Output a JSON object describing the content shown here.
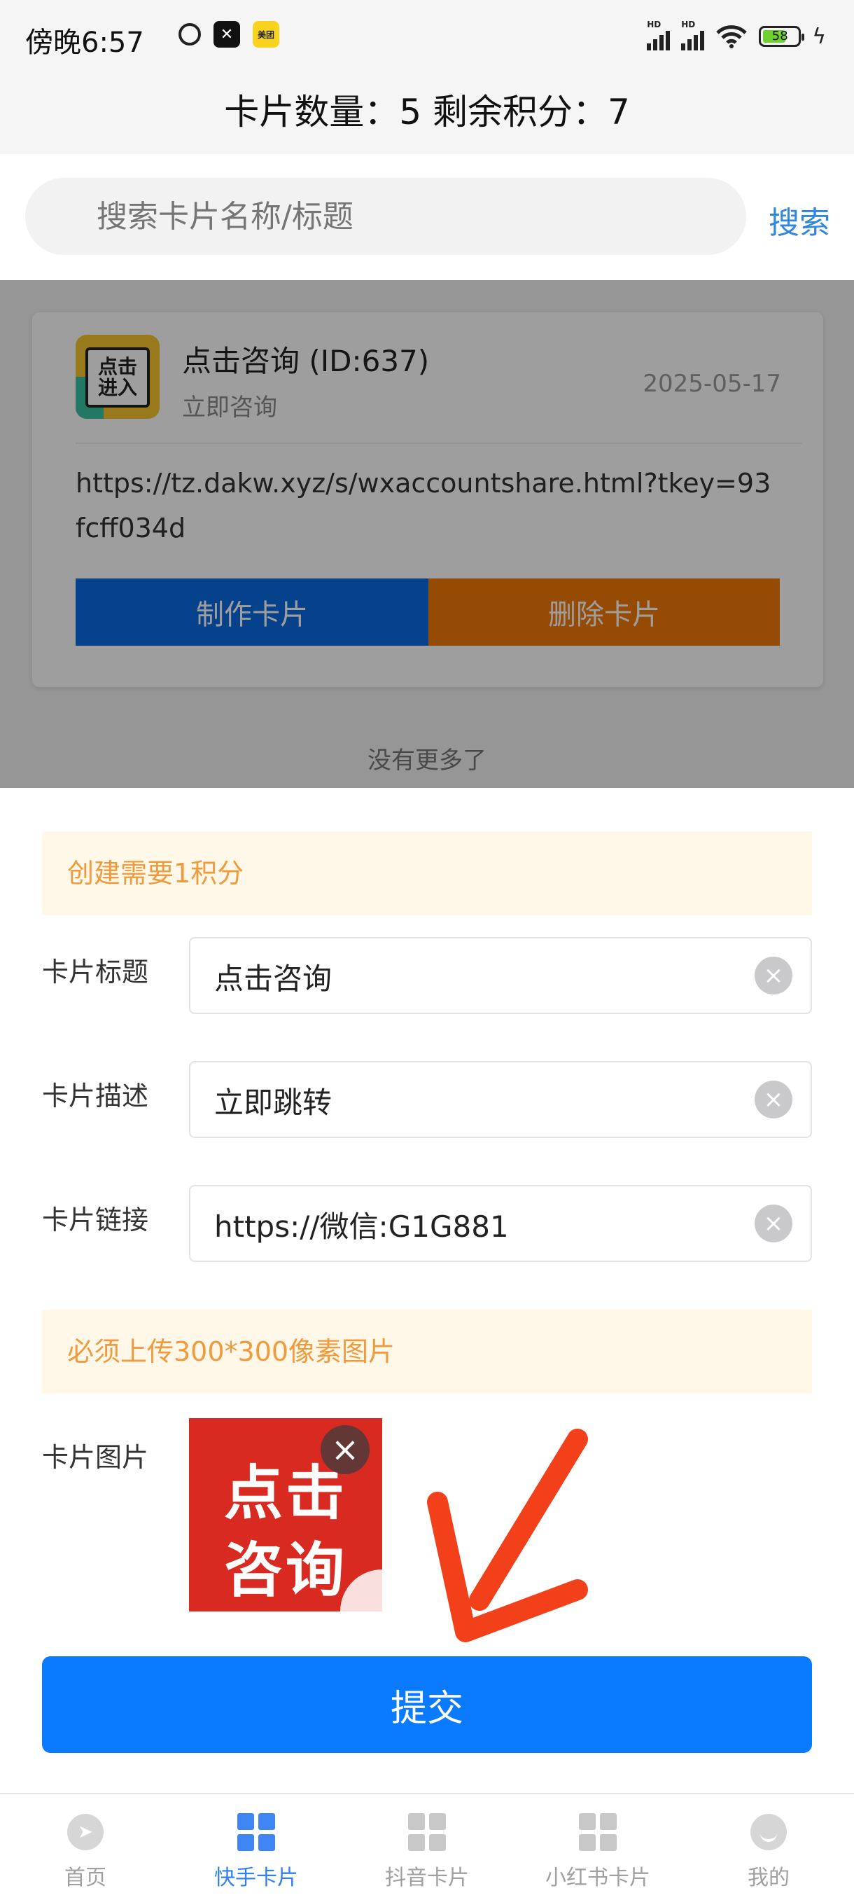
{
  "status_bar": {
    "time": "傍晚6:57",
    "battery": "58",
    "network_labels": [
      "HD",
      "HD"
    ],
    "meituan_label": "美团"
  },
  "header": {
    "title": "卡片数量：5 剩余积分：7"
  },
  "search": {
    "placeholder": "搜索卡片名称/标题",
    "button_label": "搜索"
  },
  "card_list": {
    "items": [
      {
        "title": "点击咨询 (ID:637)",
        "subtitle": "立即咨询",
        "date": "2025-05-17",
        "url": "https://tz.dakw.xyz/s/wxaccountshare.html?tkey=93fcff034d",
        "thumb_text_1": "点击",
        "thumb_text_2": "进入",
        "make_label": "制作卡片",
        "delete_label": "删除卡片"
      }
    ],
    "end_text": "没有更多了"
  },
  "form": {
    "notice_points": "创建需要1积分",
    "title_label": "卡片标题",
    "title_value": "点击咨询",
    "desc_label": "卡片描述",
    "desc_value": "立即跳转",
    "link_label": "卡片链接",
    "link_value": "https://微信:G1G881",
    "notice_image": "必须上传300*300像素图片",
    "image_label": "卡片图片",
    "image_text_1": "点击",
    "image_text_2": "咨询",
    "submit_label": "提交"
  },
  "bottom_nav": {
    "items": [
      {
        "label": "首页",
        "icon": "compass-icon"
      },
      {
        "label": "快手卡片",
        "icon": "grid-icon",
        "active": true
      },
      {
        "label": "抖音卡片",
        "icon": "grid-icon"
      },
      {
        "label": "小红书卡片",
        "icon": "grid-icon"
      },
      {
        "label": "我的",
        "icon": "smile-icon"
      }
    ]
  },
  "colors": {
    "primary_blue": "#0a7bff",
    "make_button": "#0a6ae0",
    "delete_button": "#f07a08",
    "notice_text": "#f09a3e",
    "notice_bg": "#fff8e8",
    "nav_active": "#2f7ff6"
  }
}
